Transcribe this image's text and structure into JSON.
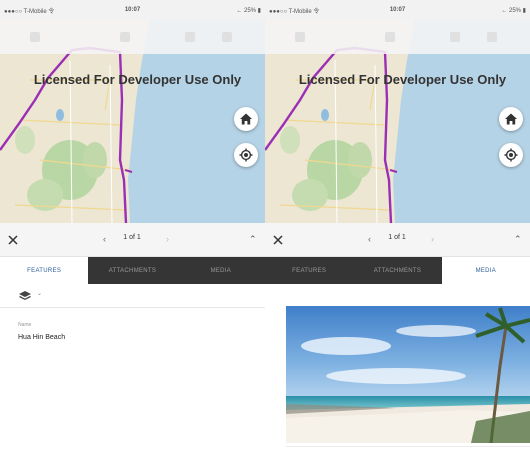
{
  "status_bar": {
    "carrier": "●●●○○ T-Mobile 令",
    "time": "10:07",
    "battery": "← 25% ▮"
  },
  "map": {
    "watermark": "Licensed For Developer Use Only",
    "home_icon": "home-icon",
    "locate_icon": "locate-icon",
    "land_color": "#ece6d3",
    "water_color": "#b5d3e6",
    "boundary_color": "#9b2fb4"
  },
  "popup": {
    "close_icon": "close-icon",
    "prev_glyph": "‹",
    "pager": "1 of 1",
    "next_glyph": "›",
    "collapse_glyph": "⌃"
  },
  "tabs": [
    {
      "label": "FEATURES"
    },
    {
      "label": "ATTACHMENTS"
    },
    {
      "label": "MEDIA"
    }
  ],
  "features_panel": {
    "layers_icon": "layers-icon",
    "chevron_glyph": "⌄",
    "field_label": "Name",
    "field_value": "Hua Hin Beach"
  },
  "media_panel": {
    "image_subject": "tropical-beach-photo"
  },
  "colors": {
    "tab_dark": "#353535",
    "tab_active_text": "#2a5d99"
  }
}
